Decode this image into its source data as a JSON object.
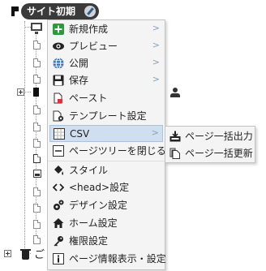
{
  "tree": {
    "root_label": "サイト初期",
    "trash_label": "ご"
  },
  "context_menu": {
    "items": [
      {
        "label": "新規作成",
        "icon": "plus-icon",
        "submenu_indicator": ">"
      },
      {
        "label": "プレビュー",
        "icon": "eye-icon",
        "submenu_indicator": ">"
      },
      {
        "label": "公開",
        "icon": "globe-icon",
        "submenu_indicator": ">"
      },
      {
        "label": "保存",
        "icon": "floppy-disk-icon",
        "submenu_indicator": ">"
      },
      {
        "label": "ペースト",
        "icon": "paste-icon"
      },
      {
        "label": "テンプレート設定",
        "icon": "template-settings-icon"
      },
      {
        "label": "CSV",
        "icon": "csv-grid-icon",
        "submenu_indicator": ">",
        "active": true
      },
      {
        "label": "ページツリーを閉じる",
        "icon": "collapse-icon"
      },
      {
        "label": "スタイル",
        "icon": "paint-bucket-icon"
      },
      {
        "label": "<head>設定",
        "icon": "code-arrows-icon"
      },
      {
        "label": "デザイン設定",
        "icon": "gears-icon"
      },
      {
        "label": "ホーム設定",
        "icon": "home-icon"
      },
      {
        "label": "権限設定",
        "icon": "key-icon"
      },
      {
        "label": "ページ情報表示・設定",
        "icon": "info-icon"
      }
    ]
  },
  "csv_submenu": {
    "items": [
      {
        "label": "ページ一括出力",
        "icon": "export-tray-icon"
      },
      {
        "label": "ページ一括更新",
        "icon": "copy-pages-icon"
      }
    ]
  },
  "colors": {
    "menu_background": "#f4f4f4",
    "active_item": "#cfdff0",
    "root_node": "#3a3a3a",
    "add_green": "#2a9a3a",
    "globe_blue": "#2f6fb6"
  }
}
